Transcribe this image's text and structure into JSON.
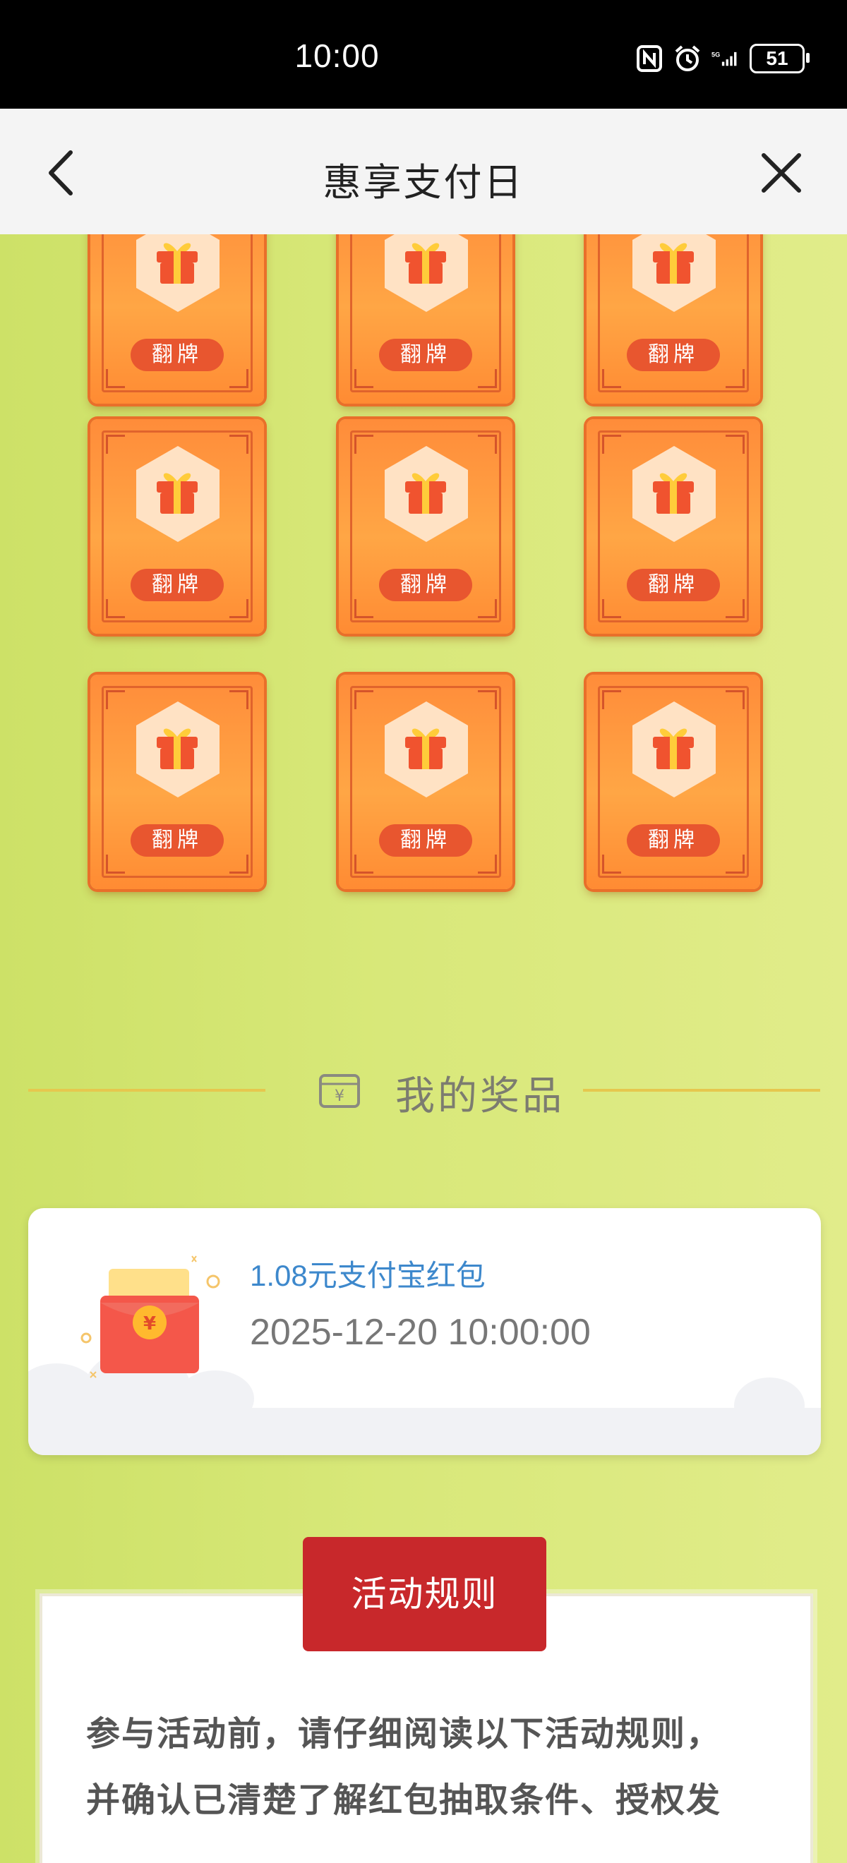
{
  "status_bar": {
    "time": "10:00",
    "battery": "51",
    "icons": [
      "nfc-icon",
      "alarm-icon",
      "signal-5g-icon",
      "battery-icon"
    ]
  },
  "nav": {
    "title": "惠享支付日",
    "back_icon": "chevron-left-icon",
    "close_icon": "close-icon"
  },
  "flip_cards": {
    "button_label": "翻牌",
    "rows": 3,
    "columns": 3
  },
  "prizes": {
    "title": "我的奖品",
    "items": [
      {
        "name": "1.08元支付宝红包",
        "time": "2025-12-20 10:00:00"
      }
    ]
  },
  "rules": {
    "button_label": "活动规则",
    "text_lines": [
      "参与活动前，请仔细阅读以下活动规则，",
      "并确认已清楚了解红包抽取条件、授权发"
    ]
  },
  "colors": {
    "card_orange": "#ff8c3a",
    "card_button": "#e8562f",
    "rules_red": "#c8282b",
    "prize_blue": "#3d88cc",
    "background_green": "#d7e67f"
  }
}
